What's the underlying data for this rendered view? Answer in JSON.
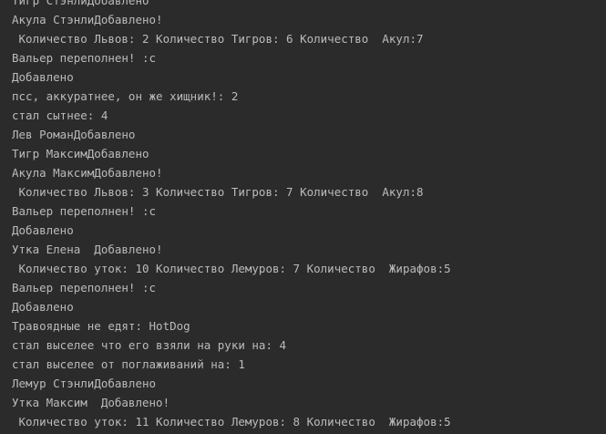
{
  "console": {
    "lines": [
      "Тигр СтэнлиДобавлено",
      "Акула СтэнлиДобавлено!",
      " Количество Львов: 2 Количество Тигров: 6 Количество  Акул:7",
      "Вальер переполнен! :c",
      "Добавлено",
      "псс, аккуратнее, он же хищник!: 2",
      "стал сытнее: 4",
      "Лев РоманДобавлено",
      "Тигр МаксимДобавлено",
      "Акула МаксимДобавлено!",
      " Количество Львов: 3 Количество Тигров: 7 Количество  Акул:8",
      "Вальер переполнен! :c",
      "Добавлено",
      "Утка Елена  Добавлено!",
      " Количество уток: 10 Количество Лемуров: 7 Количество  Жирафов:5",
      "Вальер переполнен! :c",
      "Добавлено",
      "Травоядные не едят: HotDog",
      "стал выселее что его взяли на руки на: 4",
      "стал выселее от поглаживаний на: 1",
      "Лемур СтэнлиДобавлено",
      "Утка Максим  Добавлено!",
      " Количество уток: 11 Количество Лемуров: 8 Количество  Жирафов:5"
    ]
  }
}
